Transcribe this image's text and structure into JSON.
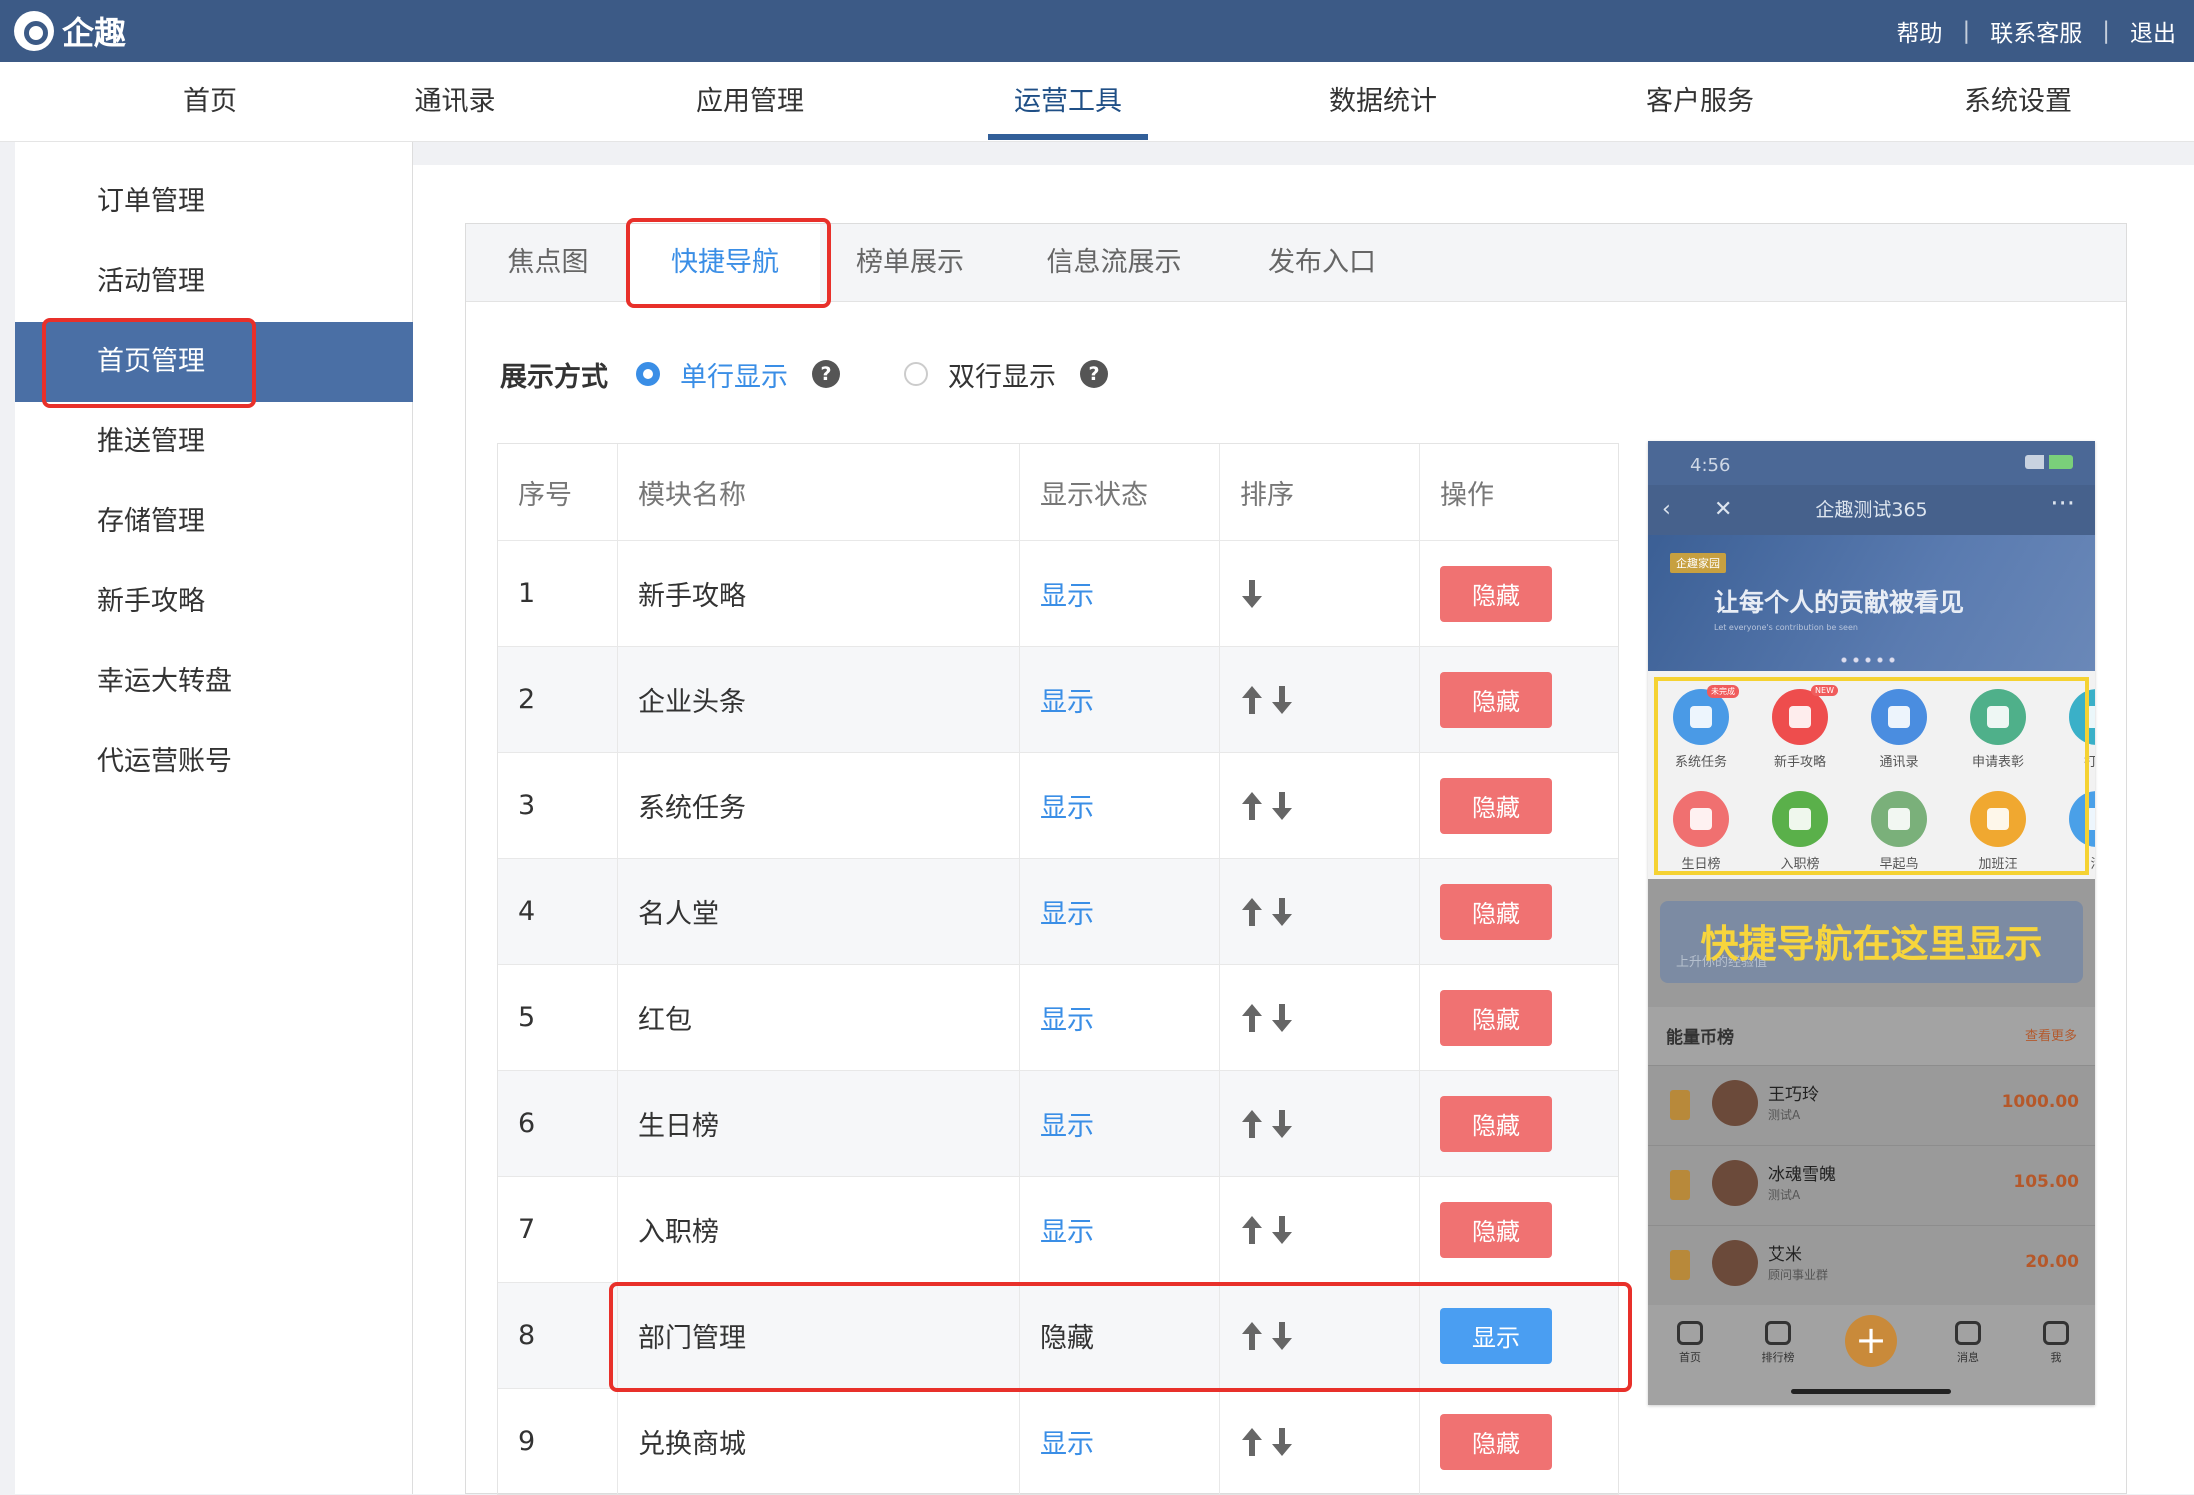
{
  "brand": {
    "name": "企趣"
  },
  "top_links": [
    "帮助",
    "联系客服",
    "退出"
  ],
  "nav": {
    "items": [
      "首页",
      "通讯录",
      "应用管理",
      "运营工具",
      "数据统计",
      "客户服务",
      "系统设置"
    ],
    "active": "运营工具"
  },
  "sidebar": {
    "items": [
      "订单管理",
      "活动管理",
      "首页管理",
      "推送管理",
      "存储管理",
      "新手攻略",
      "幸运大转盘",
      "代运营账号"
    ],
    "active": "首页管理"
  },
  "tabs": {
    "items": [
      "焦点图",
      "快捷导航",
      "榜单展示",
      "信息流展示",
      "发布入口"
    ],
    "active": "快捷导航"
  },
  "display_mode": {
    "label": "展示方式",
    "options": [
      "单行显示",
      "双行显示"
    ],
    "selected": "单行显示",
    "help": "?"
  },
  "table": {
    "headers": [
      "序号",
      "模块名称",
      "显示状态",
      "排序",
      "操作"
    ],
    "rows": [
      {
        "index": "1",
        "name": "新手攻略",
        "status": "显示",
        "action": "隐藏"
      },
      {
        "index": "2",
        "name": "企业头条",
        "status": "显示",
        "action": "隐藏"
      },
      {
        "index": "3",
        "name": "系统任务",
        "status": "显示",
        "action": "隐藏"
      },
      {
        "index": "4",
        "name": "名人堂",
        "status": "显示",
        "action": "隐藏"
      },
      {
        "index": "5",
        "name": "红包",
        "status": "显示",
        "action": "隐藏"
      },
      {
        "index": "6",
        "name": "生日榜",
        "status": "显示",
        "action": "隐藏"
      },
      {
        "index": "7",
        "name": "入职榜",
        "status": "显示",
        "action": "隐藏"
      },
      {
        "index": "8",
        "name": "部门管理",
        "status": "隐藏",
        "action": "显示"
      },
      {
        "index": "9",
        "name": "兑换商城",
        "status": "显示",
        "action": "隐藏"
      }
    ]
  },
  "phone": {
    "time": "4:56",
    "title": "企趣测试365",
    "banner_tag": "企趣家园",
    "banner_text": "让每个人的贡献被看见",
    "banner_sub": "Let everyone's contribution be seen",
    "grid": [
      {
        "label": "系统任务",
        "badge": "未完成",
        "color": "#4a9ae6"
      },
      {
        "label": "新手攻略",
        "badge": "NEW",
        "color": "#ee4d4d"
      },
      {
        "label": "通讯录",
        "badge": "",
        "color": "#4a8de0"
      },
      {
        "label": "申请表彰",
        "badge": "",
        "color": "#4fb08a"
      },
      {
        "label": "打卡",
        "badge": "",
        "color": "#3ab0c8"
      },
      {
        "label": "生日榜",
        "badge": "",
        "color": "#f07070"
      },
      {
        "label": "入职榜",
        "badge": "",
        "color": "#5ab04a"
      },
      {
        "label": "早起鸟",
        "badge": "",
        "color": "#7ab07a"
      },
      {
        "label": "加班汪",
        "badge": "",
        "color": "#f0a830"
      },
      {
        "label": "活",
        "badge": "",
        "color": "#4aa0e8"
      }
    ],
    "caption": "快捷导航在这里显示",
    "mid_sub": "上升你的经验值",
    "rank_title": "能量币榜",
    "rank_more": "查看更多",
    "ranks": [
      {
        "name": "王巧玲",
        "sub": "测试A",
        "value": "1000.00"
      },
      {
        "name": "冰魂雪魄",
        "sub": "测试A",
        "value": "105.00"
      },
      {
        "name": "艾米",
        "sub": "顾问事业群",
        "value": "20.00"
      }
    ],
    "tabbar": [
      "首页",
      "排行榜",
      "消息",
      "我"
    ]
  }
}
